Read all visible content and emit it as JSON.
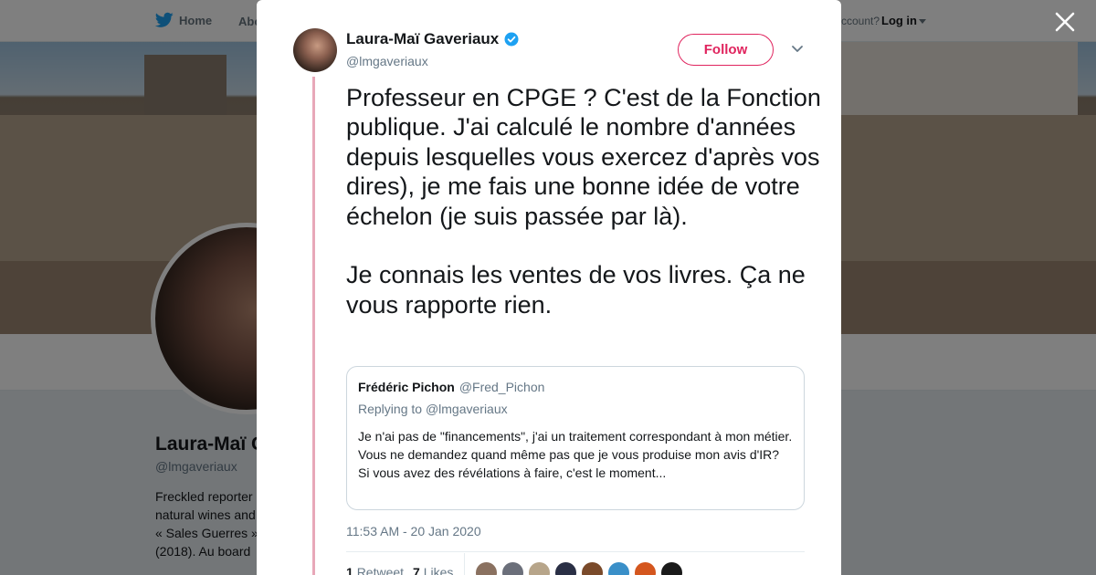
{
  "nav": {
    "home_label": "Home",
    "about_label": "Abo",
    "account_prompt": "ccount?",
    "login_label": "Log in"
  },
  "profile": {
    "name": "Laura-Maï G",
    "handle": "@lmgaveriaux",
    "bio_lines": [
      "Freckled reporter",
      "natural wines and",
      "« Sales Guerres »",
      "(2018). Au board"
    ]
  },
  "tweet": {
    "author_name": "Laura-Maï Gaveriaux",
    "author_handle": "@lmgaveriaux",
    "follow_label": "Follow",
    "text": "Professeur en CPGE ? C'est de la Fonction publique. J'ai calculé le nombre d'années depuis lesquelles vous exercez d'après vos dires), je me fais une bonne idée de votre échelon (je suis passée par là).\n\nJe connais les ventes de vos livres. Ça ne vous rapporte rien.",
    "quote": {
      "name": "Frédéric Pichon",
      "handle": "@Fred_Pichon",
      "replying_prefix": "Replying to",
      "replying_to": "@lmgaveriaux",
      "body_line1": "Je n'ai pas de \"financements\", j'ai un traitement correspondant à mon métier. Vous ne demandez quand même pas que je vous produise mon avis d'IR?",
      "body_line2": "Si vous avez des révélations à faire, c'est le moment..."
    },
    "timestamp": "11:53 AM - 20 Jan 2020",
    "retweets_count": "1",
    "retweets_label": "Retweet",
    "likes_count": "7",
    "likes_label": "Likes"
  },
  "icons": {
    "twitter_bird": "bird-icon",
    "verified": "verified-badge-icon",
    "close": "close-icon",
    "chevron": "chevron-down-icon"
  },
  "colors": {
    "accent": "#1da1f2",
    "follow": "#e0245e",
    "thread_line": "#e8a8b9"
  },
  "liker_avatar_colors": [
    "#8a7160",
    "#6b6f7a",
    "#b7a58a",
    "#2a2f45",
    "#7a4a2a",
    "#3a8fc8",
    "#d4561e",
    "#1a1a1a"
  ]
}
